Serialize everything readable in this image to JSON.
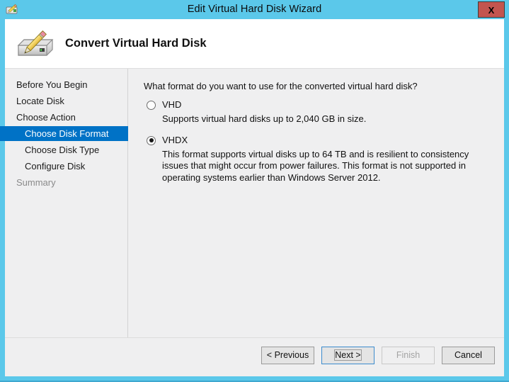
{
  "window": {
    "title": "Edit Virtual Hard Disk Wizard",
    "title_icon": "pencil-disk-icon",
    "close_label": "X",
    "accent_color": "#5bc8ea",
    "highlight_color": "#0072c6"
  },
  "header": {
    "title": "Convert Virtual Hard Disk",
    "icon": "hard-disk-pencil-icon"
  },
  "nav": {
    "items": [
      {
        "label": "Before You Begin",
        "level": 0,
        "state": "normal"
      },
      {
        "label": "Locate Disk",
        "level": 0,
        "state": "normal"
      },
      {
        "label": "Choose Action",
        "level": 0,
        "state": "normal"
      },
      {
        "label": "Choose Disk Format",
        "level": 1,
        "state": "active"
      },
      {
        "label": "Choose Disk Type",
        "level": 1,
        "state": "normal"
      },
      {
        "label": "Configure Disk",
        "level": 1,
        "state": "normal"
      },
      {
        "label": "Summary",
        "level": 0,
        "state": "disabled"
      }
    ]
  },
  "content": {
    "question": "What format do you want to use for the converted virtual hard disk?",
    "options": [
      {
        "label": "VHD",
        "selected": false,
        "description": "Supports virtual hard disks up to 2,040 GB in size."
      },
      {
        "label": "VHDX",
        "selected": true,
        "description": "This format supports virtual disks up to 64 TB and is resilient to consistency issues that might occur from power failures. This format is not supported in operating systems earlier than Windows Server 2012."
      }
    ]
  },
  "footer": {
    "buttons": [
      {
        "label": "< Previous",
        "state": "normal"
      },
      {
        "label": "Next >",
        "state": "focused"
      },
      {
        "label": "Finish",
        "state": "disabled"
      },
      {
        "label": "Cancel",
        "state": "normal"
      }
    ]
  }
}
